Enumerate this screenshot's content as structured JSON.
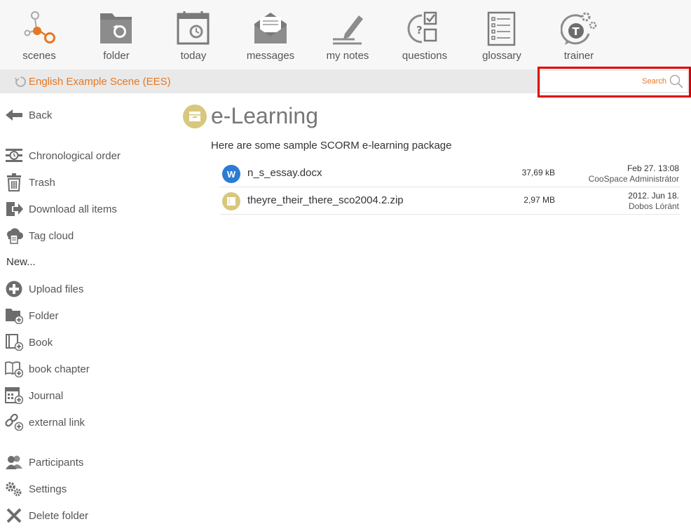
{
  "nav": {
    "items": [
      {
        "label": "scenes",
        "icon": "scenes-icon"
      },
      {
        "label": "folder",
        "icon": "folder-icon"
      },
      {
        "label": "today",
        "icon": "calendar-today-icon"
      },
      {
        "label": "messages",
        "icon": "envelope-icon"
      },
      {
        "label": "my notes",
        "icon": "pencil-notes-icon"
      },
      {
        "label": "questions",
        "icon": "questions-icon"
      },
      {
        "label": "glossary",
        "icon": "glossary-icon"
      },
      {
        "label": "trainer",
        "icon": "trainer-icon"
      }
    ]
  },
  "scene_bar": {
    "scene_name": "English Example Scene (EES)",
    "search_placeholder": "Search"
  },
  "sidebar": {
    "back": "Back",
    "actions": [
      {
        "label": "Chronological order",
        "icon": "chronological-order-icon"
      },
      {
        "label": "Trash",
        "icon": "trash-icon"
      },
      {
        "label": "Download all items",
        "icon": "download-all-icon"
      },
      {
        "label": "Tag cloud",
        "icon": "tag-cloud-icon"
      }
    ],
    "new_heading": "New...",
    "new_items": [
      {
        "label": "Upload files",
        "icon": "upload-plus-icon"
      },
      {
        "label": "Folder",
        "icon": "new-folder-icon"
      },
      {
        "label": "Book",
        "icon": "new-book-icon"
      },
      {
        "label": "book chapter",
        "icon": "new-book-chapter-icon"
      },
      {
        "label": "Journal",
        "icon": "new-journal-icon"
      },
      {
        "label": "external link",
        "icon": "new-external-link-icon"
      }
    ],
    "bottom_items": [
      {
        "label": "Participants",
        "icon": "participants-icon"
      },
      {
        "label": "Settings",
        "icon": "settings-gears-icon"
      },
      {
        "label": "Delete folder",
        "icon": "delete-x-icon"
      }
    ]
  },
  "main": {
    "title": "e-Learning",
    "description": "Here are some sample SCORM e-learning package",
    "files": [
      {
        "name": "n_s_essay.docx",
        "size": "37,69 kB",
        "date": "Feb 27. 13:08",
        "author": "CooSpace Administrátor",
        "icon": "word-document-icon",
        "icon_letter": "W"
      },
      {
        "name": "theyre_their_there_sco2004.2.zip",
        "size": "2,97 MB",
        "date": "2012. Jun 18.",
        "author": "Dobos Lóránt",
        "icon": "scorm-package-icon"
      }
    ]
  },
  "colors": {
    "accent": "#e87722",
    "highlight_border": "#e00000",
    "title_icon_bg": "#d8c77e",
    "word_icon_bg": "#2b7cd3",
    "icon_gray": "#6d6d6d"
  }
}
